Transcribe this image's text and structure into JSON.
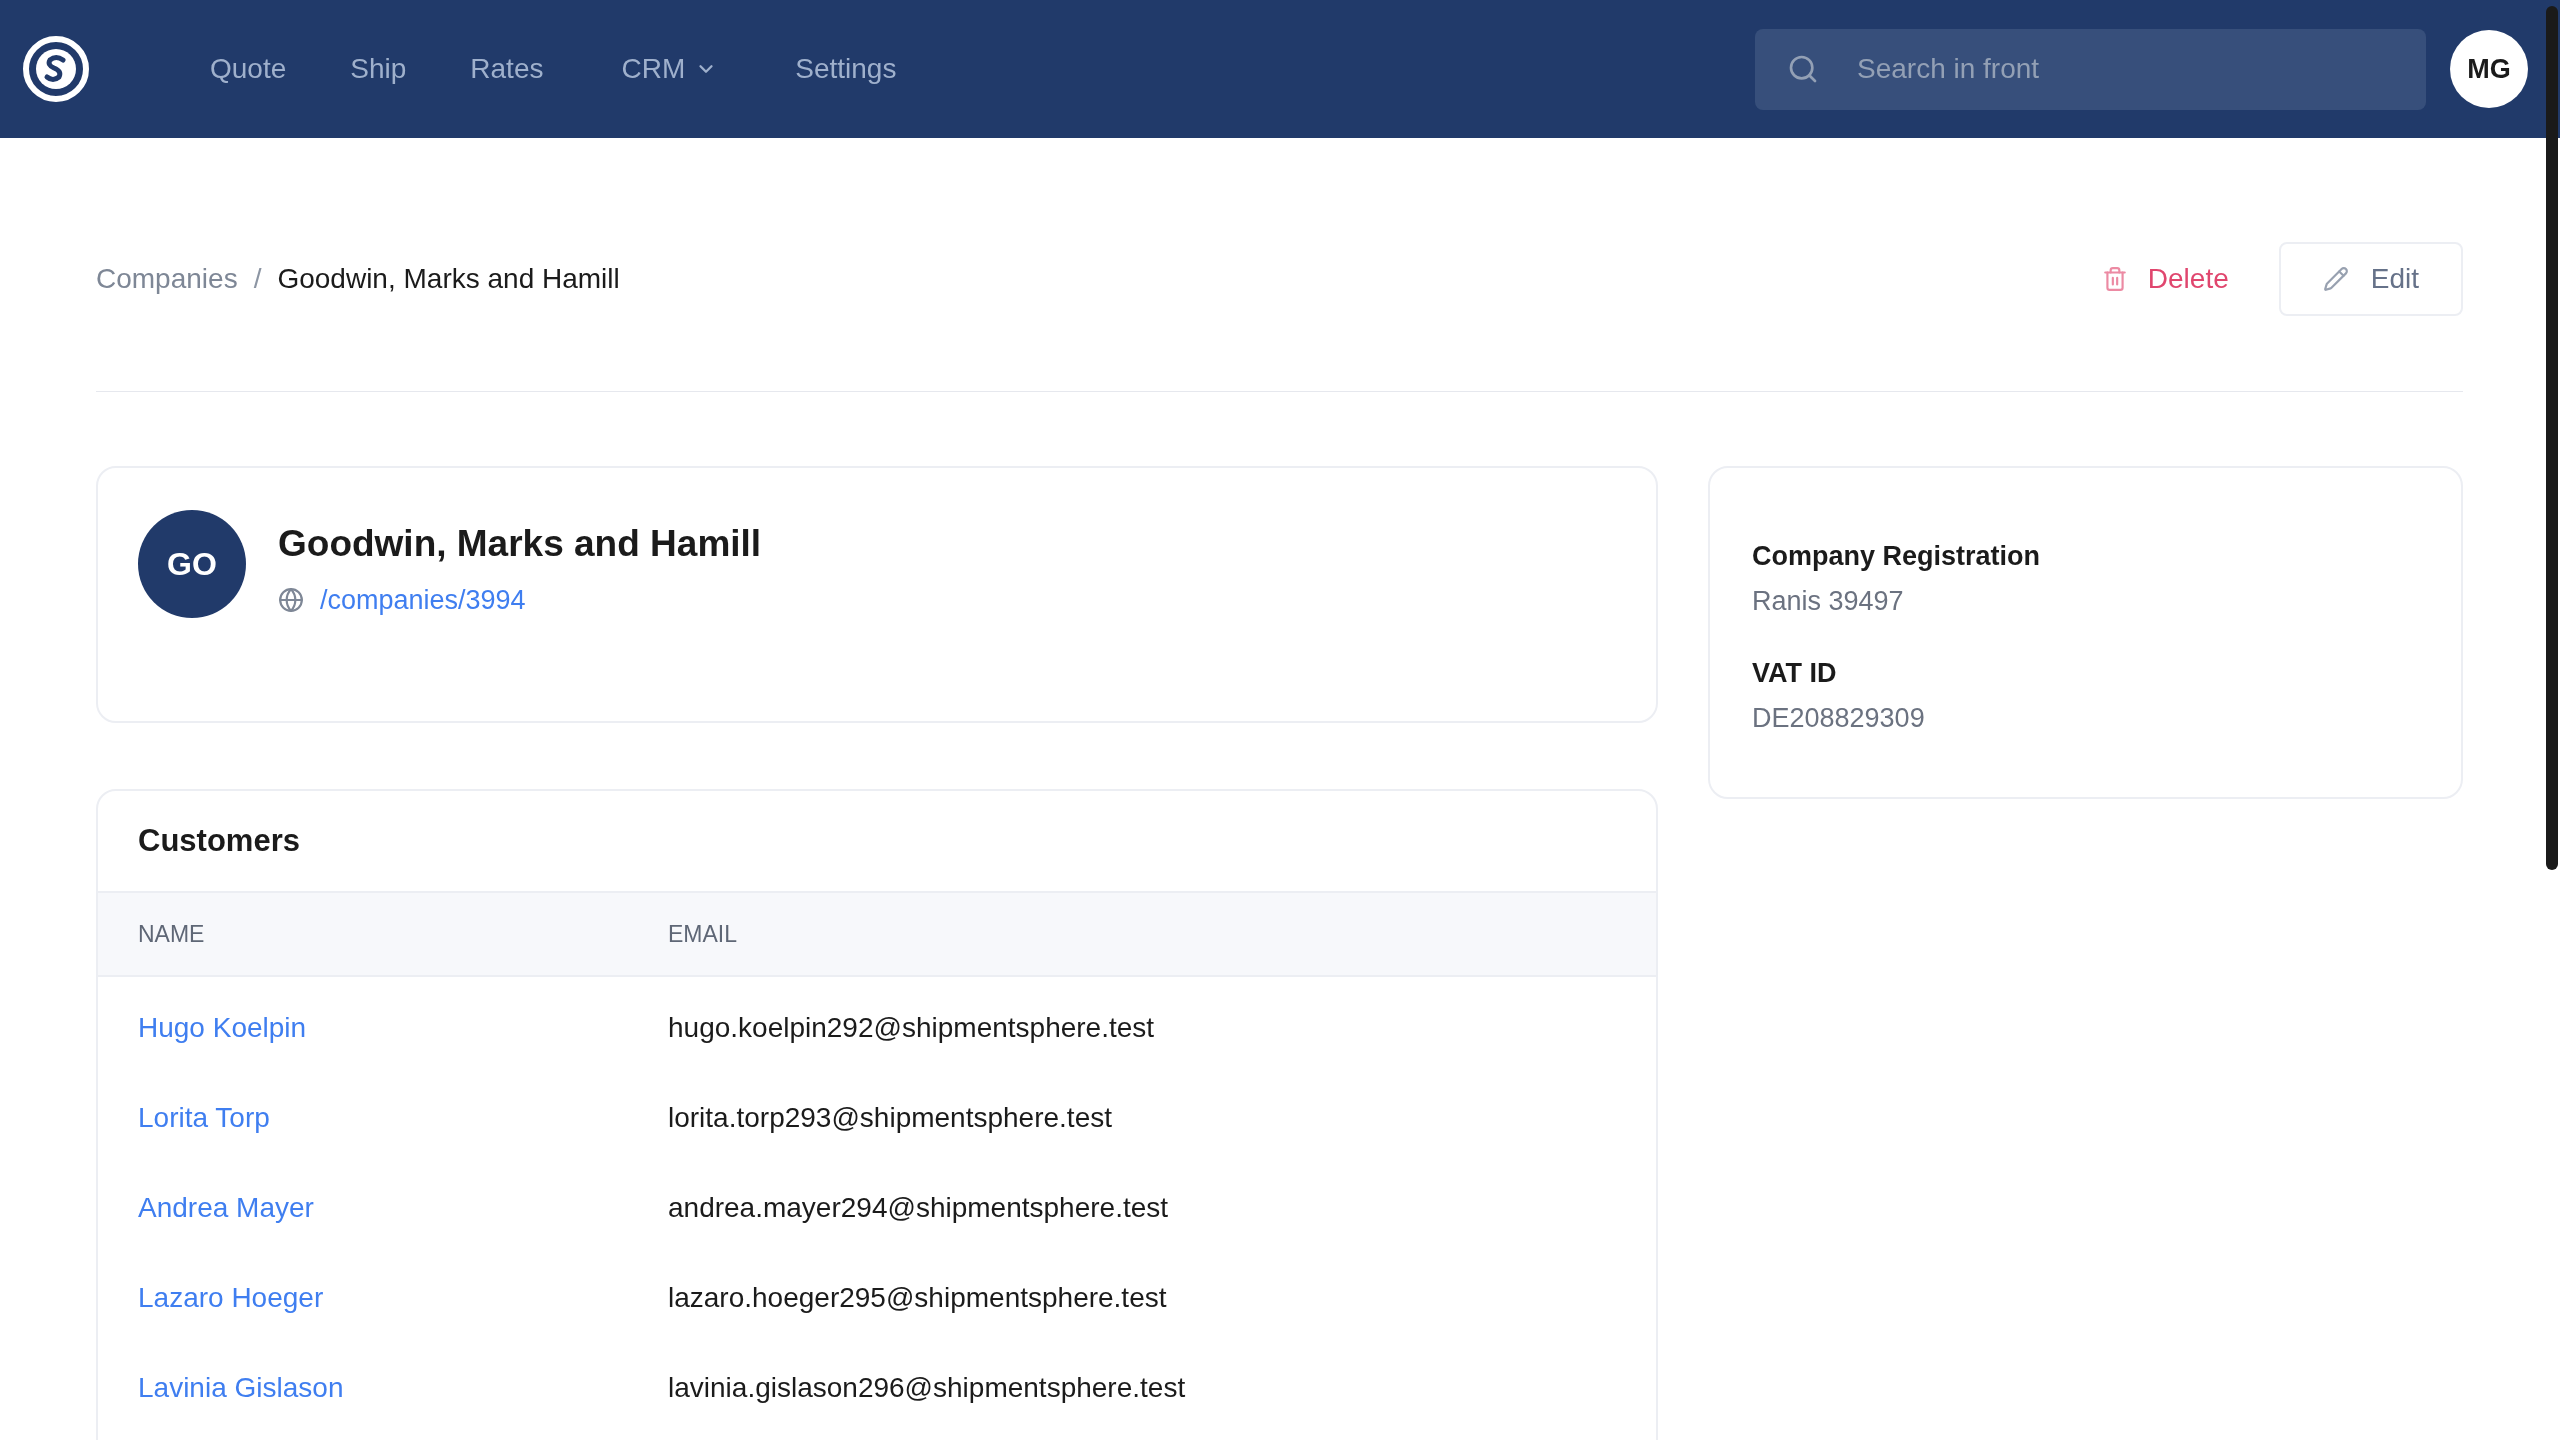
{
  "nav": {
    "items": [
      {
        "label": "Quote",
        "dropdown": false
      },
      {
        "label": "Ship",
        "dropdown": false
      },
      {
        "label": "Rates",
        "dropdown": false
      },
      {
        "label": "CRM",
        "dropdown": true
      },
      {
        "label": "Settings",
        "dropdown": false
      }
    ],
    "search": {
      "placeholder": "Search in front"
    },
    "avatar": "MG"
  },
  "breadcrumb": {
    "separator": "/",
    "items": [
      "Companies",
      "Goodwin, Marks and Hamill"
    ]
  },
  "actions": {
    "delete": "Delete",
    "edit": "Edit"
  },
  "company": {
    "initials": "GO",
    "name": "Goodwin, Marks and Hamill",
    "link": "/companies/3994"
  },
  "details": [
    {
      "label": "Company Registration",
      "value": "Ranis 39497"
    },
    {
      "label": "VAT ID",
      "value": "DE208829309"
    }
  ],
  "customers": {
    "title": "Customers",
    "columns": [
      "NAME",
      "EMAIL"
    ],
    "rows": [
      {
        "name": "Hugo Koelpin",
        "email": "hugo.koelpin292@shipmentsphere.test"
      },
      {
        "name": "Lorita Torp",
        "email": "lorita.torp293@shipmentsphere.test"
      },
      {
        "name": "Andrea Mayer",
        "email": "andrea.mayer294@shipmentsphere.test"
      },
      {
        "name": "Lazaro Hoeger",
        "email": "lazaro.hoeger295@shipmentsphere.test"
      },
      {
        "name": "Lavinia Gislason",
        "email": "lavinia.gislason296@shipmentsphere.test"
      }
    ]
  }
}
